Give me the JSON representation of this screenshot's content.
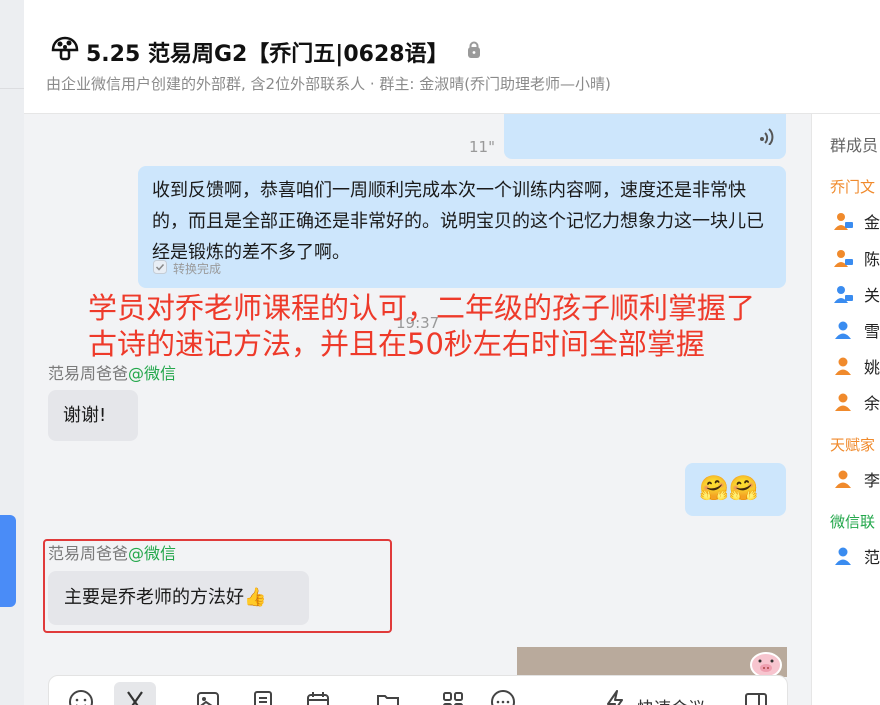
{
  "header": {
    "title": "5.25 范易周G2【乔门五|0628语】",
    "subtitle": "由企业微信用户创建的外部群, 含2位外部联系人 · 群主: 金淑晴(乔门助理老师—小晴)",
    "title_icon": "mushroom-icon",
    "lock_icon": "lock-icon"
  },
  "messages": {
    "voice": {
      "duration": "11\"",
      "icon": "voice-wave-icon"
    },
    "msg1": {
      "text": "收到反馈啊，恭喜咱们一周顺利完成本次一个训练内容啊，速度还是非常快的，而且是全部正确还是非常好的。说明宝贝的这个记忆力想象力这一块儿已经是锻炼的差不多了啊。",
      "status": "转换完成"
    },
    "time1": "19:37",
    "sender1": {
      "name": "范易周爸爸",
      "suffix": "@微信"
    },
    "msg2": {
      "text": "谢谢!"
    },
    "msg3": {
      "emoji": "🤗🤗"
    },
    "sender2": {
      "name": "范易周爸爸",
      "suffix": "@微信"
    },
    "msg4": {
      "text": "主要是乔老师的方法好👍"
    }
  },
  "annotation": {
    "line1": "学员对乔老师课程的认可，二年级的孩子顺利掌握了",
    "line2": "古诗的速记方法，并且在50秒左右时间全部掌握",
    "color": "#ee3a2a"
  },
  "toolbar": {
    "quick_meeting": "快速会议",
    "icons": [
      "emoji-icon",
      "scissors-icon",
      "image-icon",
      "document-icon",
      "calendar-icon",
      "folder-icon",
      "apps-icon",
      "chat-icon",
      "lightning-icon",
      "more-icon"
    ]
  },
  "members_panel": {
    "title": "群成员",
    "group1": {
      "name": "乔门文",
      "color": "#f08a2c"
    },
    "group1_members": [
      "金",
      "陈",
      "关",
      "雪",
      "姚",
      "余"
    ],
    "group2": {
      "name": "天赋家",
      "color": "#f08a2c"
    },
    "group2_members": [
      "李"
    ],
    "group3": {
      "name": "微信联",
      "color": "#23a74b"
    },
    "group3_members": [
      "范"
    ]
  }
}
